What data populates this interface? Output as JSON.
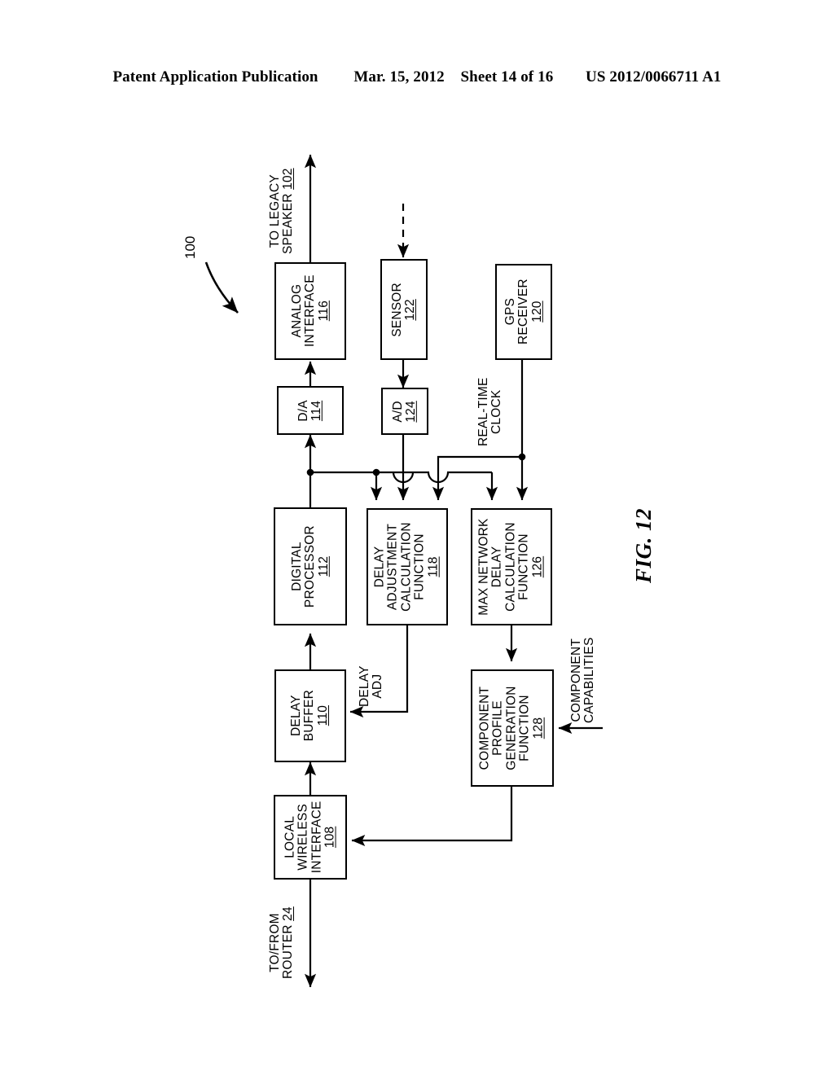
{
  "header": {
    "left": "Patent Application Publication",
    "date": "Mar. 15, 2012",
    "sheet": "Sheet 14 of 16",
    "pub_number": "US 2012/0066711 A1"
  },
  "figure": {
    "label": "FIG. 12",
    "system_ref": "100"
  },
  "blocks": [
    {
      "id": "analog-interface",
      "name": "ANALOG\nINTERFACE",
      "line1": "ANALOG",
      "line2": "INTERFACE",
      "num": "116"
    },
    {
      "id": "sensor",
      "name": "SENSOR",
      "line1": "SENSOR",
      "line2": "",
      "num": "122"
    },
    {
      "id": "gps-receiver",
      "name": "GPS\nRECEIVER",
      "line1": "GPS",
      "line2": "RECEIVER",
      "num": "120"
    },
    {
      "id": "da-converter",
      "name": "D/A",
      "line1": "D/A",
      "line2": "",
      "num": "114"
    },
    {
      "id": "ad-converter",
      "name": "A/D",
      "line1": "A/D",
      "line2": "",
      "num": "124"
    },
    {
      "id": "digital-processor",
      "name": "DIGITAL\nPROCESSOR",
      "line1": "DIGITAL",
      "line2": "PROCESSOR",
      "num": "112"
    },
    {
      "id": "delay-adjustment-calculation-function",
      "name": "DELAY ADJUSTMENT CALCULATION FUNCTION",
      "line1": "DELAY",
      "line2": "ADJUSTMENT",
      "line3": "CALCULATION",
      "line4": "FUNCTION",
      "num": "118"
    },
    {
      "id": "max-network-delay-calculation-function",
      "name": "MAX NETWORK DELAY CALCULATION FUNCTION",
      "line1": "MAX NETWORK",
      "line2": "DELAY",
      "line3": "CALCULATION",
      "line4": "FUNCTION",
      "num": "126"
    },
    {
      "id": "delay-buffer",
      "name": "DELAY\nBUFFER",
      "line1": "DELAY",
      "line2": "BUFFER",
      "num": "110"
    },
    {
      "id": "component-profile-generation-function",
      "name": "COMPONENT PROFILE GENERATION FUNCTION",
      "line1": "COMPONENT",
      "line2": "PROFILE",
      "line3": "GENERATION",
      "line4": "FUNCTION",
      "num": "128"
    },
    {
      "id": "local-wireless-interface",
      "name": "LOCAL WIRELESS INTERFACE",
      "line1": "LOCAL",
      "line2": "WIRELESS",
      "line3": "INTERFACE",
      "num": "108"
    }
  ],
  "labels": {
    "to_legacy_speaker_line1": "TO LEGACY",
    "to_legacy_speaker_line2": "SPEAKER ",
    "to_legacy_speaker_num": "102",
    "real_time_clock_line1": "REAL-TIME",
    "real_time_clock_line2": "CLOCK",
    "delay_adj_line1": "DELAY",
    "delay_adj_line2": "ADJ",
    "component_capabilities_line1": "COMPONENT",
    "component_capabilities_line2": "CAPABILITIES",
    "to_from_router_line1": "TO/FROM",
    "to_from_router_line2": "ROUTER ",
    "to_from_router_num": "24"
  },
  "colors": {
    "ink": "#000000",
    "paper": "#ffffff"
  }
}
